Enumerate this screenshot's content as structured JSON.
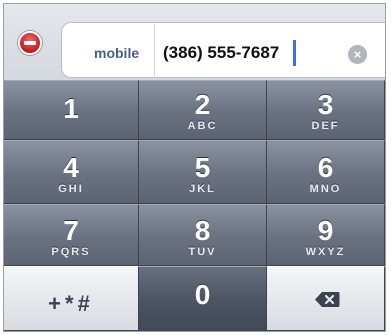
{
  "field": {
    "label": "mobile",
    "value": "(386) 555-7687",
    "clear_icon": "×"
  },
  "keypad": {
    "keys": [
      {
        "digit": "1",
        "letters": ""
      },
      {
        "digit": "2",
        "letters": "ABC"
      },
      {
        "digit": "3",
        "letters": "DEF"
      },
      {
        "digit": "4",
        "letters": "GHI"
      },
      {
        "digit": "5",
        "letters": "JKL"
      },
      {
        "digit": "6",
        "letters": "MNO"
      },
      {
        "digit": "7",
        "letters": "PQRS"
      },
      {
        "digit": "8",
        "letters": "TUV"
      },
      {
        "digit": "9",
        "letters": "WXYZ"
      }
    ],
    "symbols_label": "+*#",
    "zero": "0"
  },
  "colors": {
    "delete_red": "#c41b1b",
    "label_blue": "#4a5d86",
    "caret_blue": "#3f6ee0",
    "key_gray": "#6a7282"
  },
  "icons": {
    "delete": "minus-circle-icon",
    "clear": "clear-x-icon",
    "backspace": "backspace-icon"
  }
}
